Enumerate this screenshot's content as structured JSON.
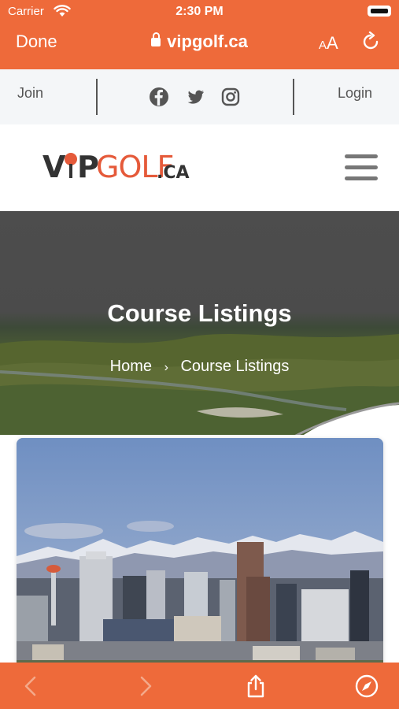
{
  "status_bar": {
    "carrier": "Carrier",
    "time": "2:30 PM"
  },
  "browser": {
    "done_label": "Done",
    "url": "vipgolf.ca",
    "text_size_label_small": "A",
    "text_size_label_large": "A"
  },
  "topbar": {
    "join_label": "Join",
    "login_label": "Login",
    "social_icons": [
      "facebook-icon",
      "twitter-icon",
      "instagram-icon"
    ]
  },
  "logo": {
    "v": "V",
    "p": "P",
    "golf": "GOLF",
    "ca": ".CA"
  },
  "hero": {
    "title": "Course Listings",
    "breadcrumb": {
      "home": "Home",
      "separator": "›",
      "current": "Course Listings"
    }
  },
  "colors": {
    "brand_orange": "#ee6a3a",
    "logo_orange": "#e55a3a",
    "dark": "#333333"
  }
}
